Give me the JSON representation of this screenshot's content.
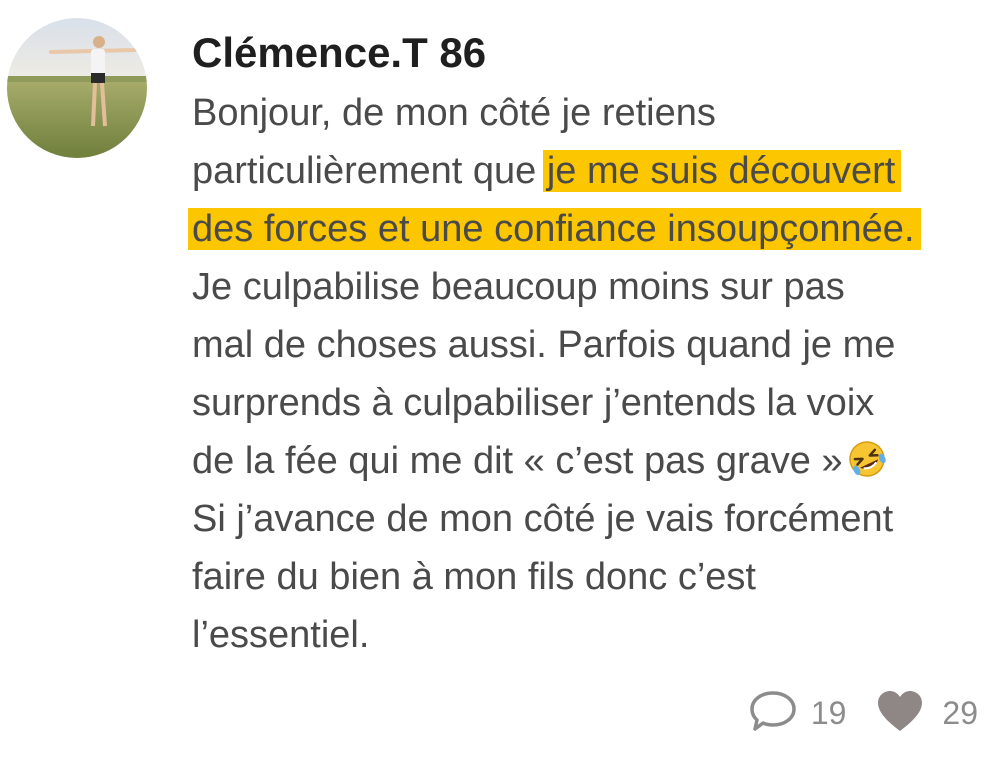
{
  "post": {
    "author": "Clémence.T 86",
    "avatar_icon": "user-photo-avatar",
    "lines": [
      {
        "pre": "Bonjour, de mon côté je retiens",
        "hl": "",
        "post": ""
      },
      {
        "pre": "particulièrement que ",
        "hl": "je me suis découvert",
        "post": ""
      },
      {
        "pre": "",
        "hl": "des forces et une confiance insoupçonnée.",
        "post": ""
      },
      {
        "pre": "Je culpabilise beaucoup moins sur pas",
        "hl": "",
        "post": ""
      },
      {
        "pre": "mal de choses aussi. Parfois quand je me",
        "hl": "",
        "post": ""
      },
      {
        "pre": "surprends à culpabiliser j’entends la voix",
        "hl": "",
        "post": ""
      },
      {
        "pre": "de la fée qui me dit « c’est pas grave »",
        "hl": "",
        "post": ""
      },
      {
        "pre": "Si j’avance de mon côté je vais forcément",
        "hl": "",
        "post": ""
      },
      {
        "pre": "faire du bien à mon fils donc c’est",
        "hl": "",
        "post": ""
      },
      {
        "pre": "l’essentiel.",
        "hl": "",
        "post": ""
      }
    ],
    "emoji": "rolling-on-floor-laughing-emoji",
    "highlight_color": "#fcc600",
    "comments_count": "19",
    "likes_count": "29",
    "comment_icon": "speech-bubble-icon",
    "like_icon": "heart-icon"
  }
}
